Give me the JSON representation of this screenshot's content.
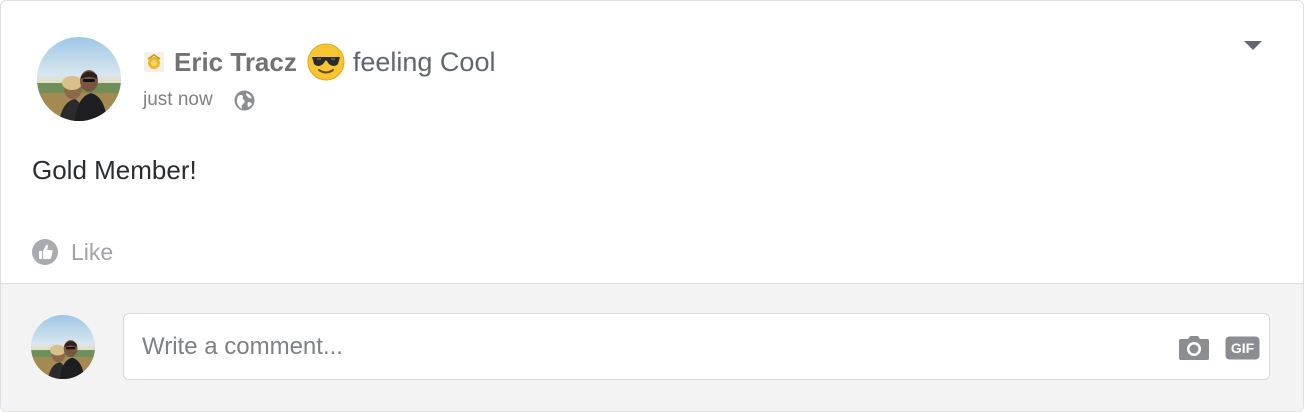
{
  "post": {
    "author": "Eric Tracz",
    "feeling": "feeling Cool",
    "timestamp": "just now",
    "privacy_icon": "globe-icon",
    "badge_icon": "gold-badge-icon",
    "feeling_icon": "sunglasses-emoji-icon",
    "body": "Gold Member!",
    "like_label": "Like"
  },
  "comment": {
    "placeholder": "Write a comment...",
    "camera_icon": "camera-icon",
    "gif_label": "GIF"
  },
  "colors": {
    "author": "#717274",
    "border": "#dddfe2",
    "comment_bg": "#f3f3f3",
    "icon_gray": "#8a8d91",
    "emoji_yellow": "#f7c531"
  }
}
